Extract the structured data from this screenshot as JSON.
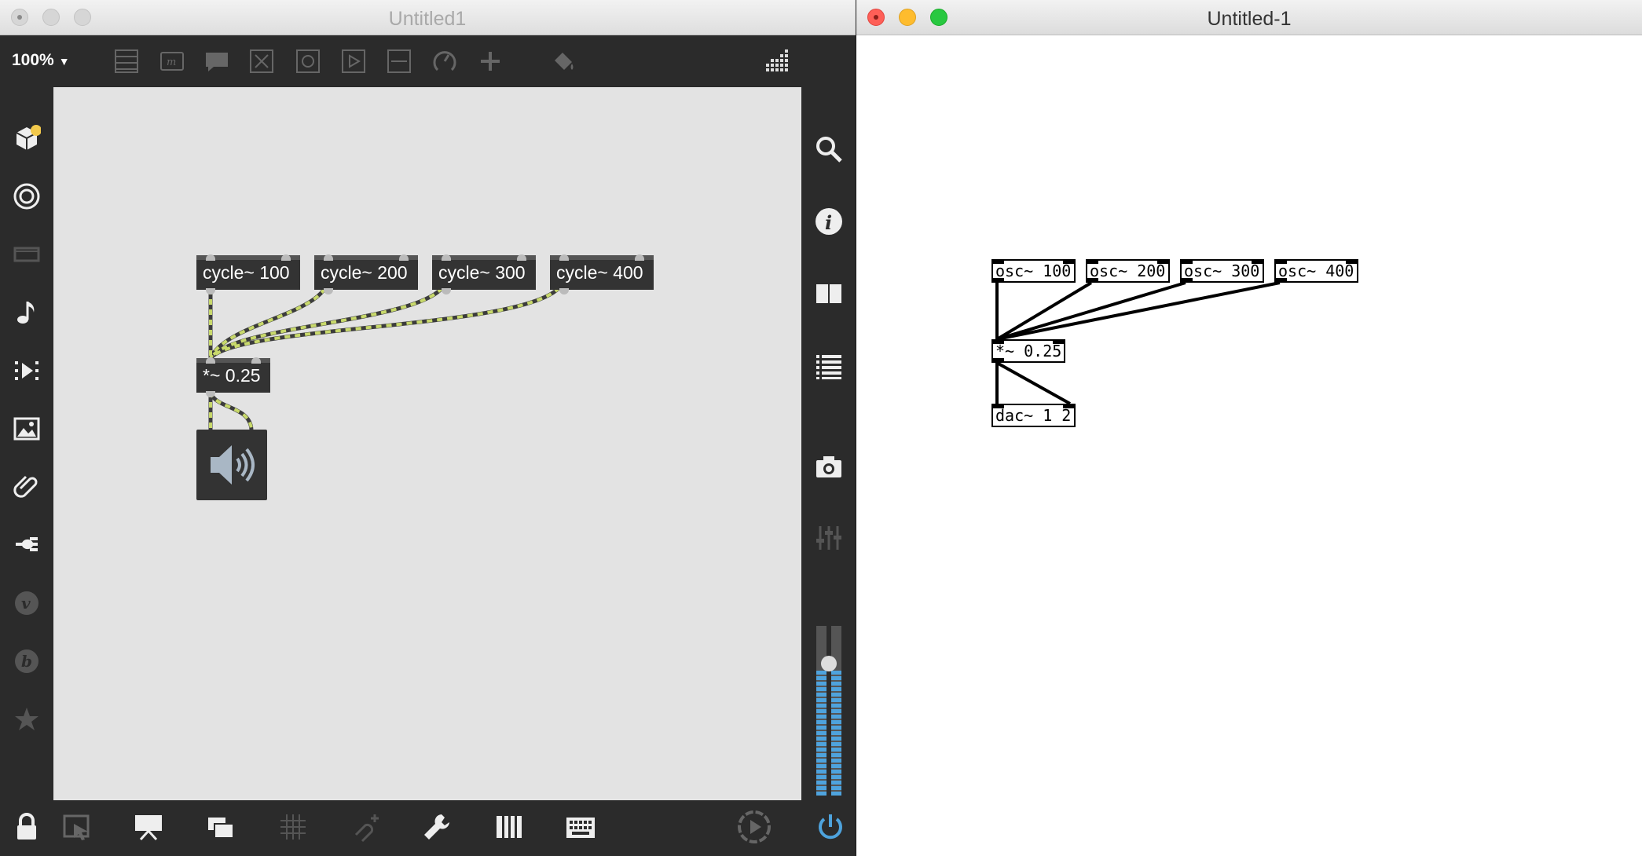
{
  "max_window": {
    "title": "Untitled1",
    "zoom": "100%",
    "zoom_arrow": "▼",
    "toolbar_icons": [
      "message-box-icon",
      "comment-icon",
      "speech-bubble-icon",
      "toggle-x-icon",
      "button-icon",
      "play-icon",
      "slider-icon",
      "dial-icon",
      "add-object-icon",
      "paint-bucket-icon",
      "grid-palette-icon"
    ],
    "left_rail_icons": [
      "packages-icon",
      "target-icon",
      "console-icon",
      "music-note-icon",
      "media-icon",
      "image-icon",
      "paperclip-icon",
      "plugin-icon",
      "vimeo-icon",
      "bold-b-icon",
      "star-icon"
    ],
    "right_rail_icons": [
      "search-icon",
      "info-icon",
      "book-icon",
      "list-icon",
      "camera-icon",
      "mixer-icon"
    ],
    "bottom_icons": [
      "lock-icon",
      "presentation-select-icon",
      "presentation-icon",
      "windows-icon",
      "grid-icon",
      "pin-add-icon",
      "wrench-icon",
      "piano-keys-icon",
      "keyboard-icon",
      "play-circle-icon",
      "power-icon"
    ],
    "objects": {
      "cycle1": "cycle~ 100",
      "cycle2": "cycle~ 200",
      "cycle3": "cycle~ 300",
      "cycle4": "cycle~ 400",
      "mult": "*~ 0.25"
    },
    "ezdac_icon": "speaker-icon",
    "meter_level": 0.75,
    "colors": {
      "panel": "#2b2b2b",
      "canvas": "#e3e3e3",
      "cord": "#c8d96b",
      "meter": "#4ea3dd"
    }
  },
  "pd_window": {
    "title": "Untitled-1",
    "objects": {
      "osc1": "osc~ 100",
      "osc2": "osc~ 200",
      "osc3": "osc~ 300",
      "osc4": "osc~ 400",
      "mult": "*~ 0.25",
      "dac": "dac~ 1 2"
    }
  }
}
